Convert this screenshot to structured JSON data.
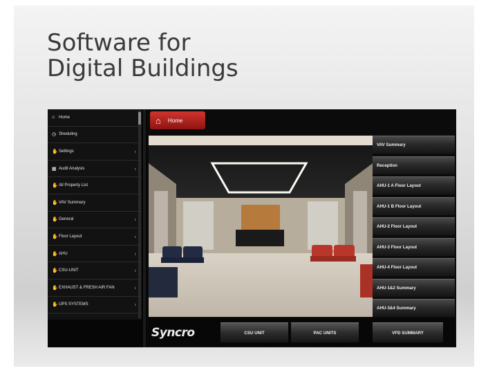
{
  "slide": {
    "title": "Software for\nDigital Buildings"
  },
  "header": {
    "home_tab": "Home"
  },
  "sidebar": {
    "items": [
      {
        "label": "Home",
        "icon": "home-icon",
        "chevron": false
      },
      {
        "label": "Sheduling",
        "icon": "clock-icon",
        "chevron": false
      },
      {
        "label": "Settings",
        "icon": "hand-icon",
        "chevron": true
      },
      {
        "label": "Audit Analysis",
        "icon": "grid-icon",
        "chevron": true
      },
      {
        "label": "All Property List",
        "icon": "hand-icon",
        "chevron": false
      },
      {
        "label": "VAV Summary",
        "icon": "hand-icon",
        "chevron": false
      },
      {
        "label": "General",
        "icon": "hand-icon",
        "chevron": true
      },
      {
        "label": "Floor Layout",
        "icon": "hand-icon",
        "chevron": true
      },
      {
        "label": "AHU",
        "icon": "hand-icon",
        "chevron": true
      },
      {
        "label": "CSU-UNIT",
        "icon": "hand-icon",
        "chevron": true
      },
      {
        "label": "EXHAUST & FRESH AIR FAN",
        "icon": "hand-icon",
        "chevron": true
      },
      {
        "label": "UPS SYSTEMS",
        "icon": "hand-icon",
        "chevron": true
      }
    ]
  },
  "right_menu": [
    "VAV Summary",
    "Reception",
    "AHU-1 A Floor Layout",
    "AHU-1 B Floor Layout",
    "AHU-2 Floor Layout",
    "AHU-3 Floor Layout",
    "AHU-4 Floor Layout",
    "AHU-1&2 Summary",
    "AHU-3&4 Summary"
  ],
  "footer": {
    "logo": "Syncro",
    "buttons": [
      "CSU UNIT",
      "PAC UNITS",
      "VFD SUMMARY"
    ]
  },
  "colors": {
    "accent": "#c0241f",
    "panel": "#121212"
  }
}
